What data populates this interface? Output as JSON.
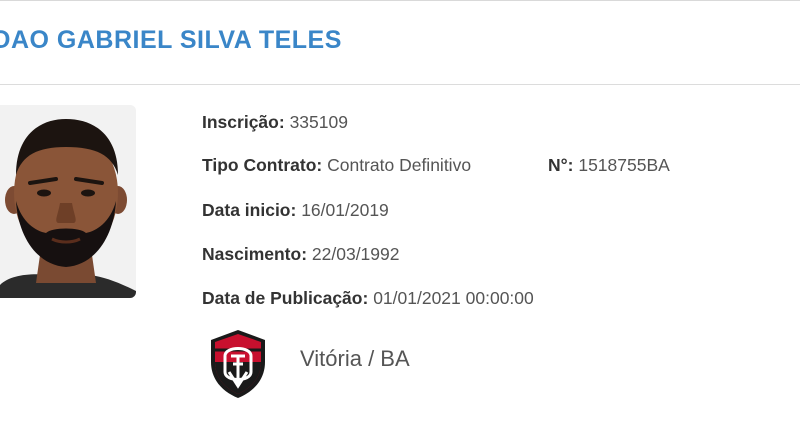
{
  "player": {
    "name": "OAO GABRIEL SILVA TELES"
  },
  "details": {
    "inscricao_label": "Inscrição:",
    "inscricao_value": "335109",
    "tipo_contrato_label": "Tipo Contrato:",
    "tipo_contrato_value": "Contrato Definitivo",
    "numero_label": "N°:",
    "numero_value": "1518755BA",
    "data_inicio_label": "Data inicio:",
    "data_inicio_value": "16/01/2019",
    "nascimento_label": "Nascimento:",
    "nascimento_value": "22/03/1992",
    "data_publicacao_label": "Data de Publicação:",
    "data_publicacao_value": "01/01/2021 00:00:00"
  },
  "club": {
    "name": "Vitória / BA",
    "crest_icon": "club-crest-icon",
    "crest_colors": [
      "#c8102e",
      "#1a1a1a",
      "#ffffff"
    ]
  },
  "colors": {
    "name_blue": "#3a86c8"
  }
}
